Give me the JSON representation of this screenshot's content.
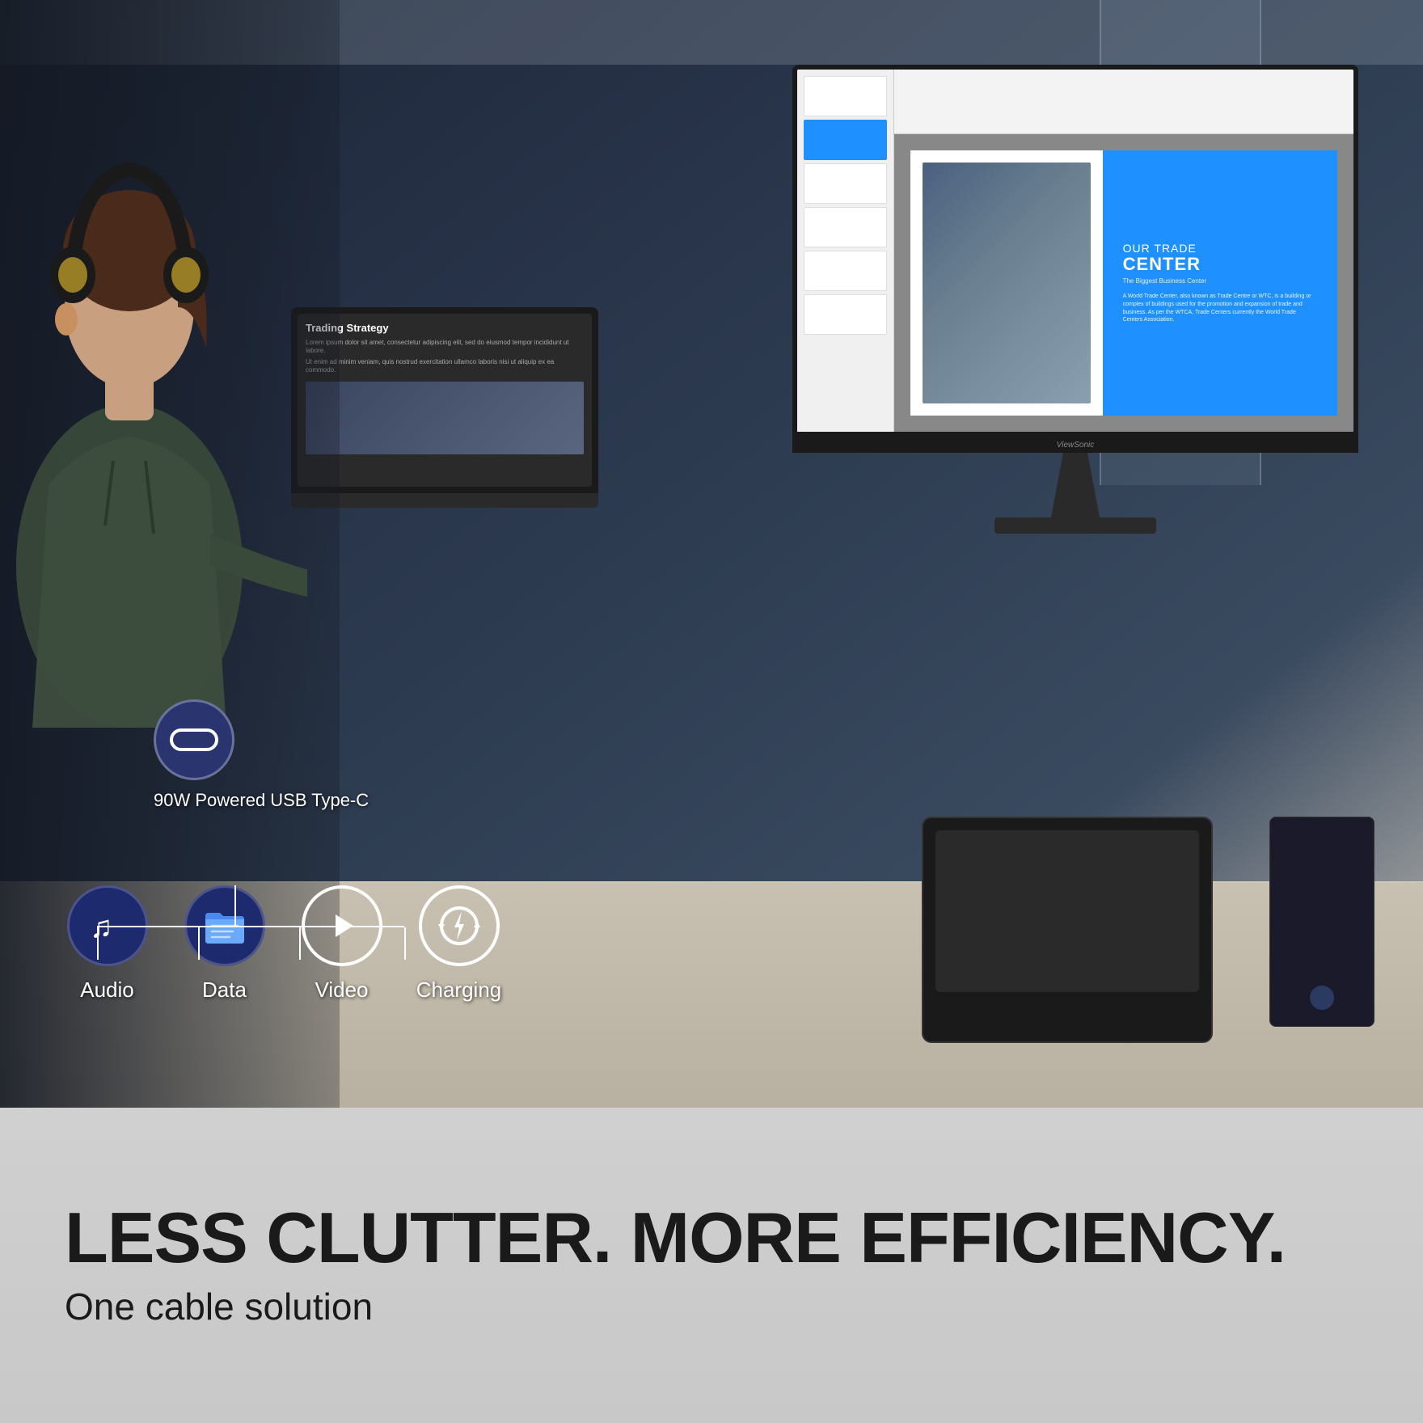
{
  "photo_section": {
    "alt": "Woman with headphones working at desk with ViewSonic monitor"
  },
  "usb_diagram": {
    "main_label": "90W Powered USB Type-C",
    "features": [
      {
        "id": "audio",
        "label": "Audio",
        "icon_type": "music",
        "circle_style": "solid"
      },
      {
        "id": "data",
        "label": "Data",
        "icon_type": "folder",
        "circle_style": "solid"
      },
      {
        "id": "video",
        "label": "Video",
        "icon_type": "play",
        "circle_style": "outline"
      },
      {
        "id": "charging",
        "label": "Charging",
        "icon_type": "charging",
        "circle_style": "outline"
      }
    ]
  },
  "slide_content": {
    "pre_title": "OUR TRADE",
    "title": "CENTER",
    "subtitle": "The Biggest Business Center",
    "body": "A World Trade Center, also known as Trade Centre or WTC, is a building or complex of buildings used for the promotion and expansion of trade and business. As per the WTCA, Trade Centers currently the World Trade Centers Association."
  },
  "laptop_content": {
    "title": "Trading Strategy",
    "body_lines": [
      "Lorem ipsum dolor sit amet, consectetur adipiscing elit, sed do eiusmod tempor incididunt ut labore.",
      "Ut enim ad minim veniam, quis nostrud exercitation ullamco laboris nisi ut aliquip ex ea commodo."
    ]
  },
  "monitor_brand": "ViewSonic",
  "bottom_banner": {
    "headline": "LESS CLUTTER. MORE EFFICIENCY.",
    "subline": "One cable solution"
  }
}
